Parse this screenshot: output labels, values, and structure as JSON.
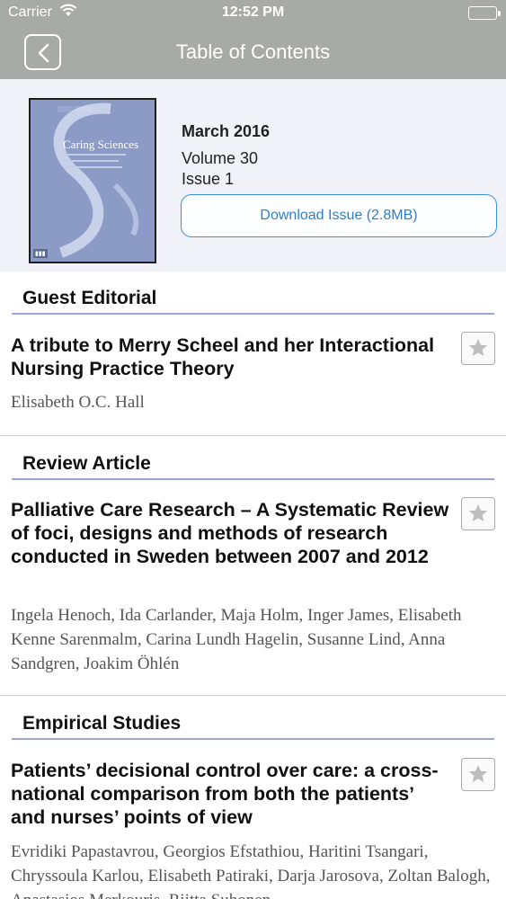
{
  "status_bar": {
    "carrier": "Carrier",
    "time": "12:52 PM"
  },
  "nav": {
    "title": "Table of Contents"
  },
  "issue": {
    "date": "March 2016",
    "volume": "Volume 30",
    "number": "Issue 1",
    "download_label": "Download Issue (2.8MB)",
    "cover_title": "Caring Sciences"
  },
  "sections": [
    {
      "heading": "Guest Editorial",
      "article": {
        "title": "A tribute to Merry Scheel and her Interactional Nursing Practice Theory",
        "authors": "Elisabeth O.C. Hall"
      }
    },
    {
      "heading": "Review Article",
      "article": {
        "title": "Palliative Care Research – A Systematic Review of foci, designs and methods of research conducted in Sweden between 2007 and 2012",
        "authors": "Ingela Henoch, Ida Carlander, Maja Holm, Inger James, Elisabeth Kenne Sarenmalm, Carina Lundh Hagelin, Susanne Lind, Anna Sandgren, Joakim Öhlén"
      }
    },
    {
      "heading": "Empirical Studies",
      "article": {
        "title": "Patients’ decisional control over care: a cross-national comparison from both the patients’ and nurses’ points of view",
        "authors": "Evridiki Papastavrou, Georgios Efstathiou, Haritini Tsangari, Chryssoula Karlou, Elisabeth Patiraki, Darja Jarosova, Zoltan Balogh, Anastasios Merkouris, Riitta Suhonen"
      }
    }
  ],
  "colors": {
    "bar": "#a7aaa7",
    "header_bg": "#f0f2f8",
    "accent": "#3d8fd6",
    "section_rule": "#9aa4d6"
  },
  "icons": {
    "back": "chevron-left-icon",
    "favorite": "star-icon",
    "wifi": "wifi-icon",
    "battery": "battery-icon"
  }
}
